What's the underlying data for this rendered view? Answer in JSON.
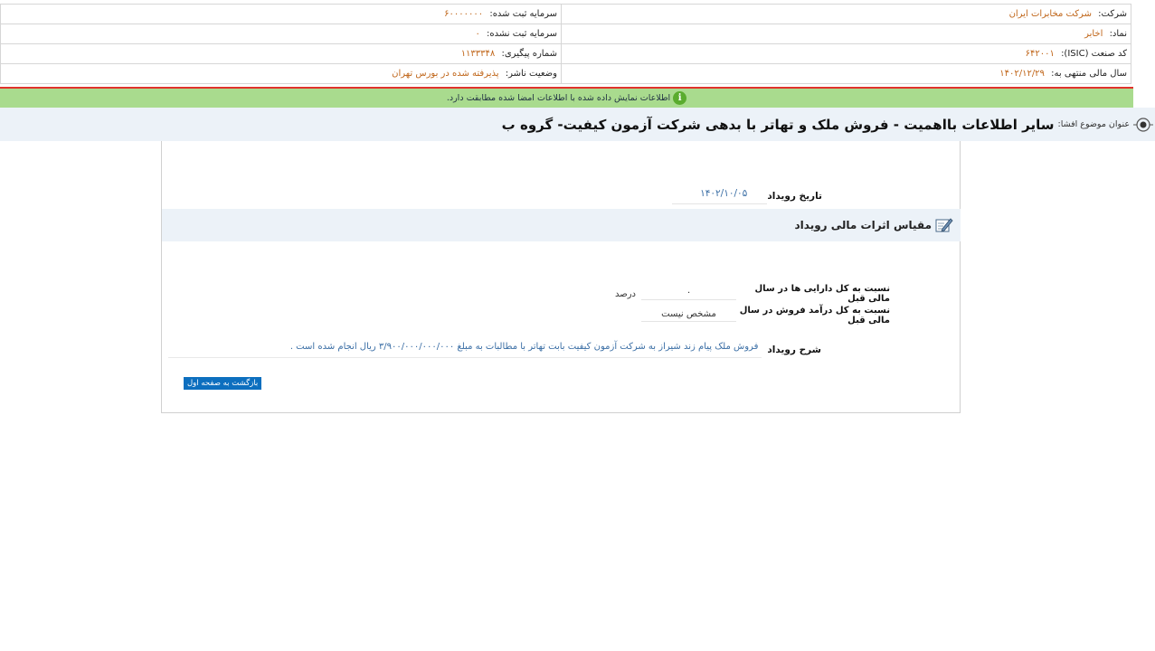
{
  "company_info": {
    "company_label": "شرکت:",
    "company_value": "شرکت مخابرات ایران",
    "registered_capital_label": "سرمایه ثبت شده:",
    "registered_capital_value": "۶۰۰۰۰۰۰۰",
    "symbol_label": "نماد:",
    "symbol_value": "اخابر",
    "unregistered_capital_label": "سرمایه ثبت نشده:",
    "unregistered_capital_value": "۰",
    "isic_label": "کد صنعت (ISIC):",
    "isic_value": "۶۴۲۰۰۱",
    "tracking_label": "شماره پیگیری:",
    "tracking_value": "۱۱۳۳۳۴۸",
    "fiscal_year_label": "سال مالی منتهی به:",
    "fiscal_year_value": "۱۴۰۲/۱۲/۲۹",
    "publisher_status_label": "وضعیت ناشر:",
    "publisher_status_value": "پذیرفته شده در بورس تهران"
  },
  "notice": {
    "icon": "info-icon",
    "text": "اطلاعات نمایش داده شده با اطلاعات امضا شده مطابقت دارد."
  },
  "title": {
    "prefix": "عنوان موضوع افشا:",
    "text": "سایر اطلاعات بااهمیت - فروش ملک و تهاتر با بدهی شرکت آزمون کیفیت- گروه ب"
  },
  "event": {
    "date_label": "تاریخ رویداد",
    "date_value": "۱۴۰۲/۱۰/۰۵"
  },
  "financial_section": {
    "title": "مقیاس اثرات مالی رویداد",
    "ratio_assets_label": "نسبت به کل دارایی ها در سال مالی قبل",
    "ratio_assets_value": "۰",
    "ratio_assets_unit": "درصد",
    "ratio_revenue_label": "نسبت به کل درآمد فروش در سال مالی قبل",
    "ratio_revenue_value": "مشخص نیست"
  },
  "description": {
    "label": "شرح رویداد",
    "text": "فروش ملک پیام زند شیراز به شرکت آزمون کیفیت بابت تهاتر با مطالبات به مبلغ ۳/۹۰۰/۰۰۰/۰۰۰/۰۰۰ ریال انجام شده است ."
  },
  "back_button": "بازگشت به صفحه اول",
  "colors": {
    "accent_orange": "#c0661a",
    "notice_green": "#a9db8e",
    "title_bg": "#ecf2f8",
    "link_blue": "#3a6ea5",
    "button_blue": "#0d6fbf",
    "red_line": "#e0322b"
  }
}
